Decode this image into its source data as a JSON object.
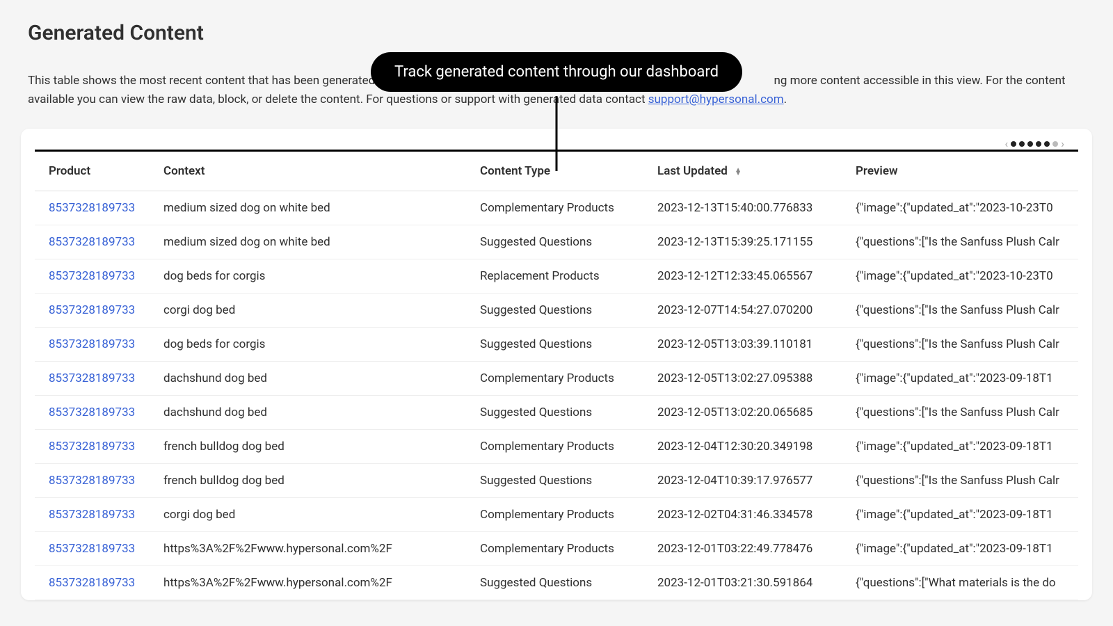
{
  "page": {
    "title": "Generated Content",
    "description_prefix": "This table shows the most recent content that has been generated by Hy",
    "description_mid": "ng more content accessible in this view. For the content available you can view the raw data, block, or delete the content. For questions or support with generated data contact ",
    "support_email": "support@hypersonal.com",
    "description_suffix": "."
  },
  "callout": {
    "text": "Track generated content through our dashboard"
  },
  "table": {
    "columns": {
      "product": "Product",
      "context": "Context",
      "content_type": "Content Type",
      "last_updated": "Last Updated",
      "preview": "Preview"
    },
    "rows": [
      {
        "product": "8537328189733",
        "context": "medium sized dog on white bed",
        "content_type": "Complementary Products",
        "last_updated": "2023-12-13T15:40:00.776833",
        "preview": "{\"image\":{\"updated_at\":\"2023-10-23T0"
      },
      {
        "product": "8537328189733",
        "context": "medium sized dog on white bed",
        "content_type": "Suggested Questions",
        "last_updated": "2023-12-13T15:39:25.171155",
        "preview": "{\"questions\":[\"Is the Sanfuss Plush Calr"
      },
      {
        "product": "8537328189733",
        "context": "dog beds for corgis",
        "content_type": "Replacement Products",
        "last_updated": "2023-12-12T12:33:45.065567",
        "preview": "{\"image\":{\"updated_at\":\"2023-10-23T0"
      },
      {
        "product": "8537328189733",
        "context": "corgi dog bed",
        "content_type": "Suggested Questions",
        "last_updated": "2023-12-07T14:54:27.070200",
        "preview": "{\"questions\":[\"Is the Sanfuss Plush Calr"
      },
      {
        "product": "8537328189733",
        "context": "dog beds for corgis",
        "content_type": "Suggested Questions",
        "last_updated": "2023-12-05T13:03:39.110181",
        "preview": "{\"questions\":[\"Is the Sanfuss Plush Calr"
      },
      {
        "product": "8537328189733",
        "context": "dachshund dog bed",
        "content_type": "Complementary Products",
        "last_updated": "2023-12-05T13:02:27.095388",
        "preview": "{\"image\":{\"updated_at\":\"2023-09-18T1"
      },
      {
        "product": "8537328189733",
        "context": "dachshund dog bed",
        "content_type": "Suggested Questions",
        "last_updated": "2023-12-05T13:02:20.065685",
        "preview": "{\"questions\":[\"Is the Sanfuss Plush Calr"
      },
      {
        "product": "8537328189733",
        "context": "french bulldog dog bed",
        "content_type": "Complementary Products",
        "last_updated": "2023-12-04T12:30:20.349198",
        "preview": "{\"image\":{\"updated_at\":\"2023-09-18T1"
      },
      {
        "product": "8537328189733",
        "context": "french bulldog dog bed",
        "content_type": "Suggested Questions",
        "last_updated": "2023-12-04T10:39:17.976577",
        "preview": "{\"questions\":[\"Is the Sanfuss Plush Calr"
      },
      {
        "product": "8537328189733",
        "context": "corgi dog bed",
        "content_type": "Complementary Products",
        "last_updated": "2023-12-02T04:31:46.334578",
        "preview": "{\"image\":{\"updated_at\":\"2023-09-18T1"
      },
      {
        "product": "8537328189733",
        "context": "https%3A%2F%2Fwww.hypersonal.com%2F",
        "content_type": "Complementary Products",
        "last_updated": "2023-12-01T03:22:49.778476",
        "preview": "{\"image\":{\"updated_at\":\"2023-09-18T1"
      },
      {
        "product": "8537328189733",
        "context": "https%3A%2F%2Fwww.hypersonal.com%2F",
        "content_type": "Suggested Questions",
        "last_updated": "2023-12-01T03:21:30.591864",
        "preview": "{\"questions\":[\"What materials is the do"
      }
    ]
  }
}
